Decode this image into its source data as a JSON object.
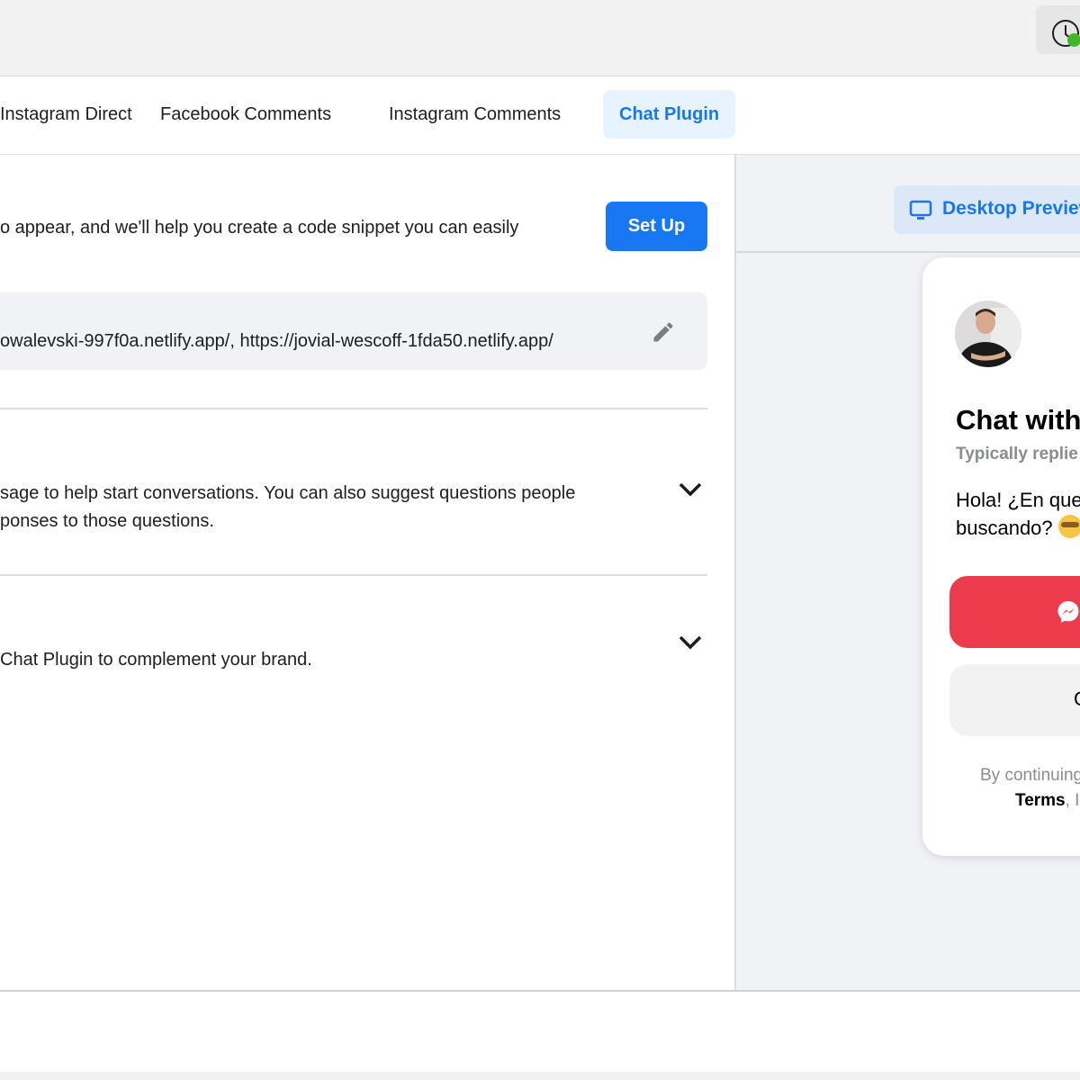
{
  "topbar": {
    "history_icon": "clock-icon",
    "status_color": "#42b72a"
  },
  "tabs": [
    {
      "label": "Instagram Direct",
      "active": false
    },
    {
      "label": "Facebook Comments",
      "active": false
    },
    {
      "label": "Instagram Comments",
      "active": false
    },
    {
      "label": "Chat Plugin",
      "active": true
    }
  ],
  "settings": {
    "setup_text": "o appear, and we'll help you create a code snippet you can easily",
    "setup_button": "Set Up",
    "domains_value": "owalevski-997f0a.netlify.app/, https://jovial-wescoff-1fda50.netlify.app/",
    "edit_icon": "pencil-icon",
    "sections": [
      {
        "text_lines": [
          "sage to help start conversations. You can also suggest questions people",
          "ponses to those questions."
        ],
        "icon": "chevron-down-icon"
      },
      {
        "text_lines": [
          "Chat Plugin to complement your brand."
        ],
        "icon": "chevron-down-icon"
      }
    ]
  },
  "preview": {
    "toggle_label": "Desktop Preview",
    "toggle_icon": "monitor-icon",
    "chat": {
      "title": "Chat with",
      "subtitle": "Typically replie",
      "greeting_line1": "Hola! ¿En que",
      "greeting_line2": "buscando?",
      "messenger_icon": "messenger-icon",
      "guest_label_partial": "C",
      "legal_line1": "By continuing",
      "legal_terms": "Terms",
      "legal_sep": ", I"
    }
  },
  "colors": {
    "accent": "#1877f2",
    "active_tab_bg": "#e7f3ff",
    "messenger_button": "#ec3b4b",
    "panel_bg": "#f0f2f5"
  }
}
